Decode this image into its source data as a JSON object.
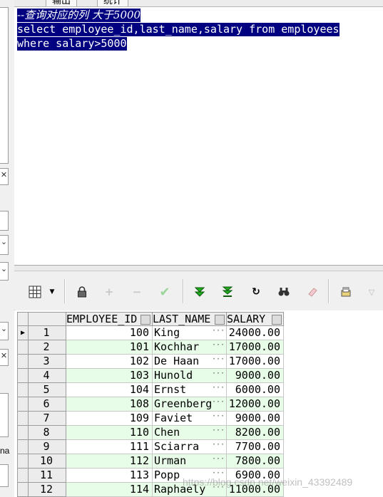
{
  "tabs": [
    "输出",
    "统计"
  ],
  "left_panel": {
    "fragment_text": "na"
  },
  "editor": {
    "lines": [
      "--查询对应的列 大于5000",
      "select employee_id,last_name,salary from employees",
      "where salary>5000"
    ]
  },
  "toolbar": {
    "icons": [
      "grid-view-icon",
      "dropdown-arrow-icon",
      "lock-icon",
      "add-record-icon",
      "delete-record-icon",
      "post-changes-icon",
      "fetch-next-icon",
      "fetch-last-icon",
      "refresh-icon",
      "find-icon",
      "clear-icon",
      "export-icon",
      "more-dropdown-icon"
    ]
  },
  "grid": {
    "columns": [
      "EMPLOYEE_ID",
      "LAST_NAME",
      "SALARY"
    ],
    "rows": [
      {
        "n": "1",
        "id": "100",
        "name": "King",
        "salary": "24000.00"
      },
      {
        "n": "2",
        "id": "101",
        "name": "Kochhar",
        "salary": "17000.00"
      },
      {
        "n": "3",
        "id": "102",
        "name": "De Haan",
        "salary": "17000.00"
      },
      {
        "n": "4",
        "id": "103",
        "name": "Hunold",
        "salary": "9000.00"
      },
      {
        "n": "5",
        "id": "104",
        "name": "Ernst",
        "salary": "6000.00"
      },
      {
        "n": "6",
        "id": "108",
        "name": "Greenberg",
        "salary": "12000.00"
      },
      {
        "n": "7",
        "id": "109",
        "name": "Faviet",
        "salary": "9000.00"
      },
      {
        "n": "8",
        "id": "110",
        "name": "Chen",
        "salary": "8200.00"
      },
      {
        "n": "9",
        "id": "111",
        "name": "Sciarra",
        "salary": "7700.00"
      },
      {
        "n": "10",
        "id": "112",
        "name": "Urman",
        "salary": "7800.00"
      },
      {
        "n": "11",
        "id": "113",
        "name": "Popp",
        "salary": "6900.00"
      },
      {
        "n": "12",
        "id": "114",
        "name": "Raphaely",
        "salary": "11000.00"
      }
    ]
  },
  "watermark": "https://blog.csdn.net/weixin_43392489"
}
